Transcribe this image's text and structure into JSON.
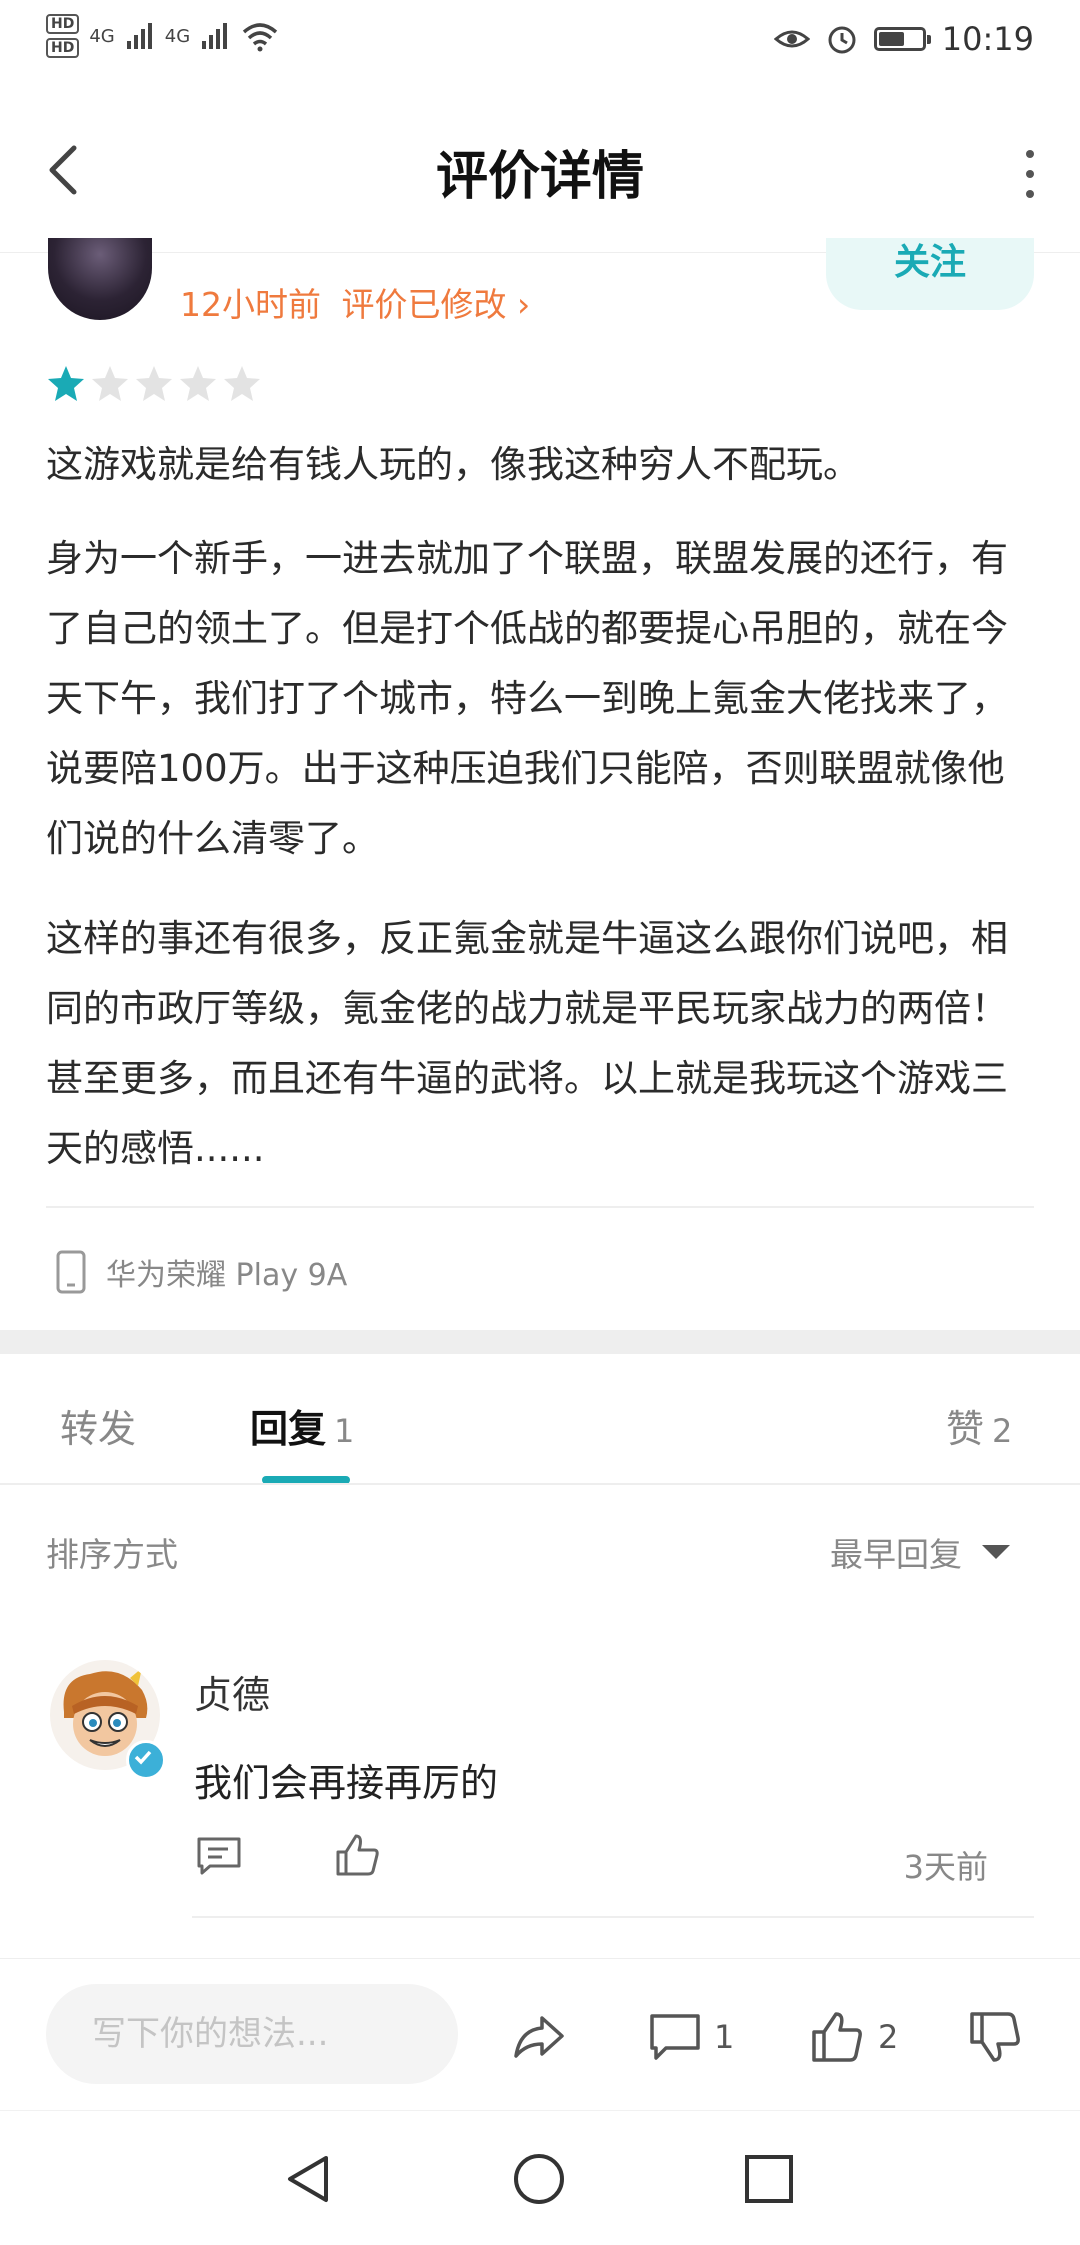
{
  "status_bar": {
    "hd1": "HD",
    "hd2": "HD",
    "sim1": "4G",
    "sim2": "4G",
    "time": "10:19",
    "battery_level": 0.6
  },
  "header": {
    "title": "评价详情"
  },
  "review": {
    "time_text": "12小时前",
    "modified_text": "评价已修改",
    "follow_label": "关注",
    "rating": 1,
    "rating_max": 5,
    "paragraphs": [
      "这游戏就是给有钱人玩的，像我这种穷人不配玩。",
      "身为一个新手，一进去就加了个联盟，联盟发展的还行，有了自己的领土了。但是打个低战的都要提心吊胆的，就在今天下午，我们打了个城市，特么一到晚上氪金大佬找来了，说要陪100万。出于这种压迫我们只能陪，否则联盟就像他们说的什么清零了。",
      "这样的事还有很多，反正氪金就是牛逼这么跟你们说吧，相同的市政厅等级，氪金佬的战力就是平民玩家战力的两倍！甚至更多，而且还有牛逼的武将。以上就是我玩这个游戏三天的感悟......"
    ],
    "device": "华为荣耀 Play 9A"
  },
  "tabs": [
    {
      "label": "转发",
      "count": ""
    },
    {
      "label": "回复",
      "count": "1"
    },
    {
      "label": "赞",
      "count": "2"
    }
  ],
  "sort": {
    "label": "排序方式",
    "value": "最早回复"
  },
  "reply": {
    "name": "贞德",
    "text": "我们会再接再厉的",
    "time": "3天前"
  },
  "bottom_bar": {
    "input_placeholder": "写下你的想法...",
    "comment_count": "1",
    "like_count": "2"
  },
  "colors": {
    "accent": "#1aaab5",
    "time_orange": "#ef7a3e",
    "follow_bg": "#e8f8f7"
  }
}
